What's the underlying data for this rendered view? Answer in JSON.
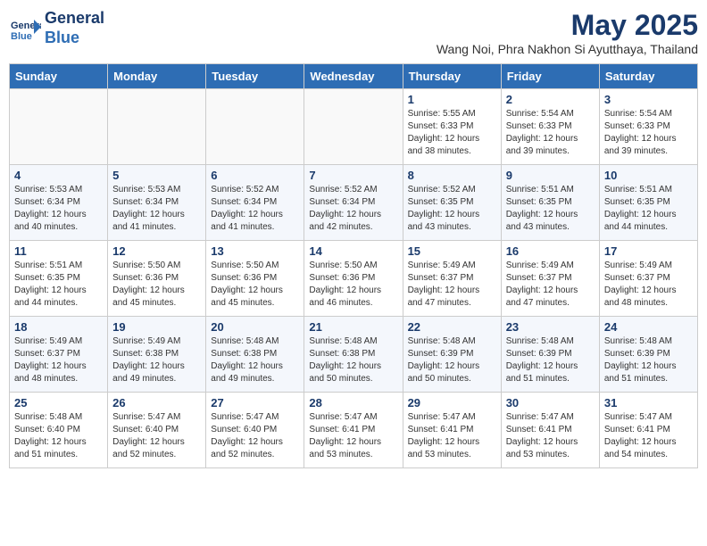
{
  "logo": {
    "line1": "General",
    "line2": "Blue"
  },
  "title": "May 2025",
  "location": "Wang Noi, Phra Nakhon Si Ayutthaya, Thailand",
  "days_of_week": [
    "Sunday",
    "Monday",
    "Tuesday",
    "Wednesday",
    "Thursday",
    "Friday",
    "Saturday"
  ],
  "weeks": [
    [
      {
        "day": "",
        "info": ""
      },
      {
        "day": "",
        "info": ""
      },
      {
        "day": "",
        "info": ""
      },
      {
        "day": "",
        "info": ""
      },
      {
        "day": "1",
        "info": "Sunrise: 5:55 AM\nSunset: 6:33 PM\nDaylight: 12 hours\nand 38 minutes."
      },
      {
        "day": "2",
        "info": "Sunrise: 5:54 AM\nSunset: 6:33 PM\nDaylight: 12 hours\nand 39 minutes."
      },
      {
        "day": "3",
        "info": "Sunrise: 5:54 AM\nSunset: 6:33 PM\nDaylight: 12 hours\nand 39 minutes."
      }
    ],
    [
      {
        "day": "4",
        "info": "Sunrise: 5:53 AM\nSunset: 6:34 PM\nDaylight: 12 hours\nand 40 minutes."
      },
      {
        "day": "5",
        "info": "Sunrise: 5:53 AM\nSunset: 6:34 PM\nDaylight: 12 hours\nand 41 minutes."
      },
      {
        "day": "6",
        "info": "Sunrise: 5:52 AM\nSunset: 6:34 PM\nDaylight: 12 hours\nand 41 minutes."
      },
      {
        "day": "7",
        "info": "Sunrise: 5:52 AM\nSunset: 6:34 PM\nDaylight: 12 hours\nand 42 minutes."
      },
      {
        "day": "8",
        "info": "Sunrise: 5:52 AM\nSunset: 6:35 PM\nDaylight: 12 hours\nand 43 minutes."
      },
      {
        "day": "9",
        "info": "Sunrise: 5:51 AM\nSunset: 6:35 PM\nDaylight: 12 hours\nand 43 minutes."
      },
      {
        "day": "10",
        "info": "Sunrise: 5:51 AM\nSunset: 6:35 PM\nDaylight: 12 hours\nand 44 minutes."
      }
    ],
    [
      {
        "day": "11",
        "info": "Sunrise: 5:51 AM\nSunset: 6:35 PM\nDaylight: 12 hours\nand 44 minutes."
      },
      {
        "day": "12",
        "info": "Sunrise: 5:50 AM\nSunset: 6:36 PM\nDaylight: 12 hours\nand 45 minutes."
      },
      {
        "day": "13",
        "info": "Sunrise: 5:50 AM\nSunset: 6:36 PM\nDaylight: 12 hours\nand 45 minutes."
      },
      {
        "day": "14",
        "info": "Sunrise: 5:50 AM\nSunset: 6:36 PM\nDaylight: 12 hours\nand 46 minutes."
      },
      {
        "day": "15",
        "info": "Sunrise: 5:49 AM\nSunset: 6:37 PM\nDaylight: 12 hours\nand 47 minutes."
      },
      {
        "day": "16",
        "info": "Sunrise: 5:49 AM\nSunset: 6:37 PM\nDaylight: 12 hours\nand 47 minutes."
      },
      {
        "day": "17",
        "info": "Sunrise: 5:49 AM\nSunset: 6:37 PM\nDaylight: 12 hours\nand 48 minutes."
      }
    ],
    [
      {
        "day": "18",
        "info": "Sunrise: 5:49 AM\nSunset: 6:37 PM\nDaylight: 12 hours\nand 48 minutes."
      },
      {
        "day": "19",
        "info": "Sunrise: 5:49 AM\nSunset: 6:38 PM\nDaylight: 12 hours\nand 49 minutes."
      },
      {
        "day": "20",
        "info": "Sunrise: 5:48 AM\nSunset: 6:38 PM\nDaylight: 12 hours\nand 49 minutes."
      },
      {
        "day": "21",
        "info": "Sunrise: 5:48 AM\nSunset: 6:38 PM\nDaylight: 12 hours\nand 50 minutes."
      },
      {
        "day": "22",
        "info": "Sunrise: 5:48 AM\nSunset: 6:39 PM\nDaylight: 12 hours\nand 50 minutes."
      },
      {
        "day": "23",
        "info": "Sunrise: 5:48 AM\nSunset: 6:39 PM\nDaylight: 12 hours\nand 51 minutes."
      },
      {
        "day": "24",
        "info": "Sunrise: 5:48 AM\nSunset: 6:39 PM\nDaylight: 12 hours\nand 51 minutes."
      }
    ],
    [
      {
        "day": "25",
        "info": "Sunrise: 5:48 AM\nSunset: 6:40 PM\nDaylight: 12 hours\nand 51 minutes."
      },
      {
        "day": "26",
        "info": "Sunrise: 5:47 AM\nSunset: 6:40 PM\nDaylight: 12 hours\nand 52 minutes."
      },
      {
        "day": "27",
        "info": "Sunrise: 5:47 AM\nSunset: 6:40 PM\nDaylight: 12 hours\nand 52 minutes."
      },
      {
        "day": "28",
        "info": "Sunrise: 5:47 AM\nSunset: 6:41 PM\nDaylight: 12 hours\nand 53 minutes."
      },
      {
        "day": "29",
        "info": "Sunrise: 5:47 AM\nSunset: 6:41 PM\nDaylight: 12 hours\nand 53 minutes."
      },
      {
        "day": "30",
        "info": "Sunrise: 5:47 AM\nSunset: 6:41 PM\nDaylight: 12 hours\nand 53 minutes."
      },
      {
        "day": "31",
        "info": "Sunrise: 5:47 AM\nSunset: 6:41 PM\nDaylight: 12 hours\nand 54 minutes."
      }
    ]
  ]
}
